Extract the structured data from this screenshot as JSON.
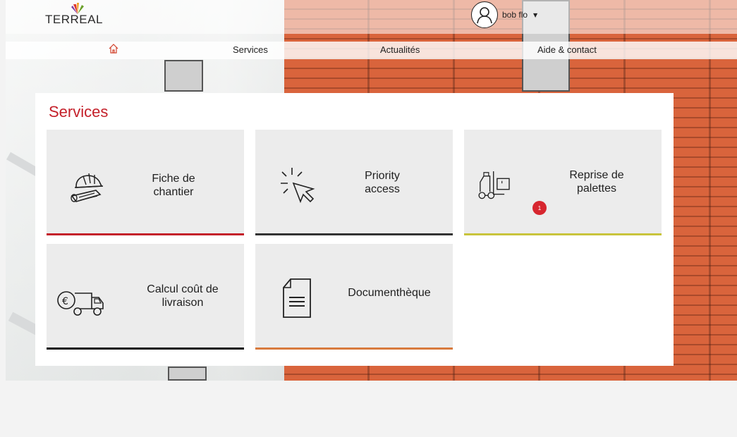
{
  "brand": {
    "name": "TERREAL"
  },
  "user": {
    "name": "bob flo"
  },
  "nav": {
    "items": [
      {
        "label": "Services"
      },
      {
        "label": "Actualités"
      },
      {
        "label": "Aide & contact"
      }
    ]
  },
  "services": {
    "title": "Services",
    "tiles": [
      {
        "label_line1": "Fiche de",
        "label_line2": "chantier",
        "accent": "#c4202a",
        "icon": "helmet-icon"
      },
      {
        "label_line1": "Priority",
        "label_line2": "access",
        "accent": "#333333",
        "icon": "cursor-click-icon"
      },
      {
        "label_line1": "Reprise de",
        "label_line2": "palettes",
        "accent": "#c8c43c",
        "icon": "forklift-icon",
        "badge": "1"
      },
      {
        "label_line1": "Calcul coût de",
        "label_line2": "livraison",
        "accent": "#111111",
        "icon": "delivery-truck-icon"
      },
      {
        "label_line1": "Documenthèque",
        "label_line2": "",
        "accent": "#d87a3e",
        "icon": "document-icon"
      }
    ]
  },
  "colors": {
    "brand_red": "#c4202a",
    "badge_red": "#d7262f"
  }
}
